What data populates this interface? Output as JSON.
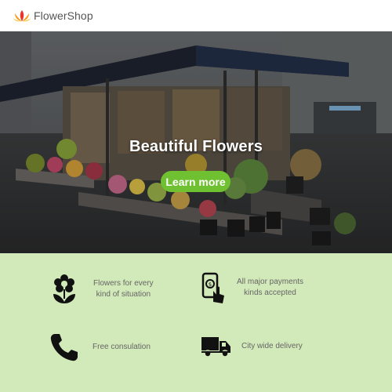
{
  "header": {
    "brand": "FlowerShop",
    "logo_icon": "lotus-logo-icon"
  },
  "hero": {
    "title": "Beautiful Flowers",
    "button_label": "Learn more",
    "accent_color": "#6fc131"
  },
  "features": {
    "background_color": "#d2e9b9",
    "items": [
      {
        "icon": "flower-icon",
        "line1": "Flowers for every",
        "line2": "kind of situation"
      },
      {
        "icon": "mobile-payment-icon",
        "line1": "All major payments",
        "line2": "kinds accepted"
      },
      {
        "icon": "phone-icon",
        "line1": "Free consulation",
        "line2": ""
      },
      {
        "icon": "delivery-truck-icon",
        "line1": "City wide delivery",
        "line2": ""
      }
    ]
  }
}
